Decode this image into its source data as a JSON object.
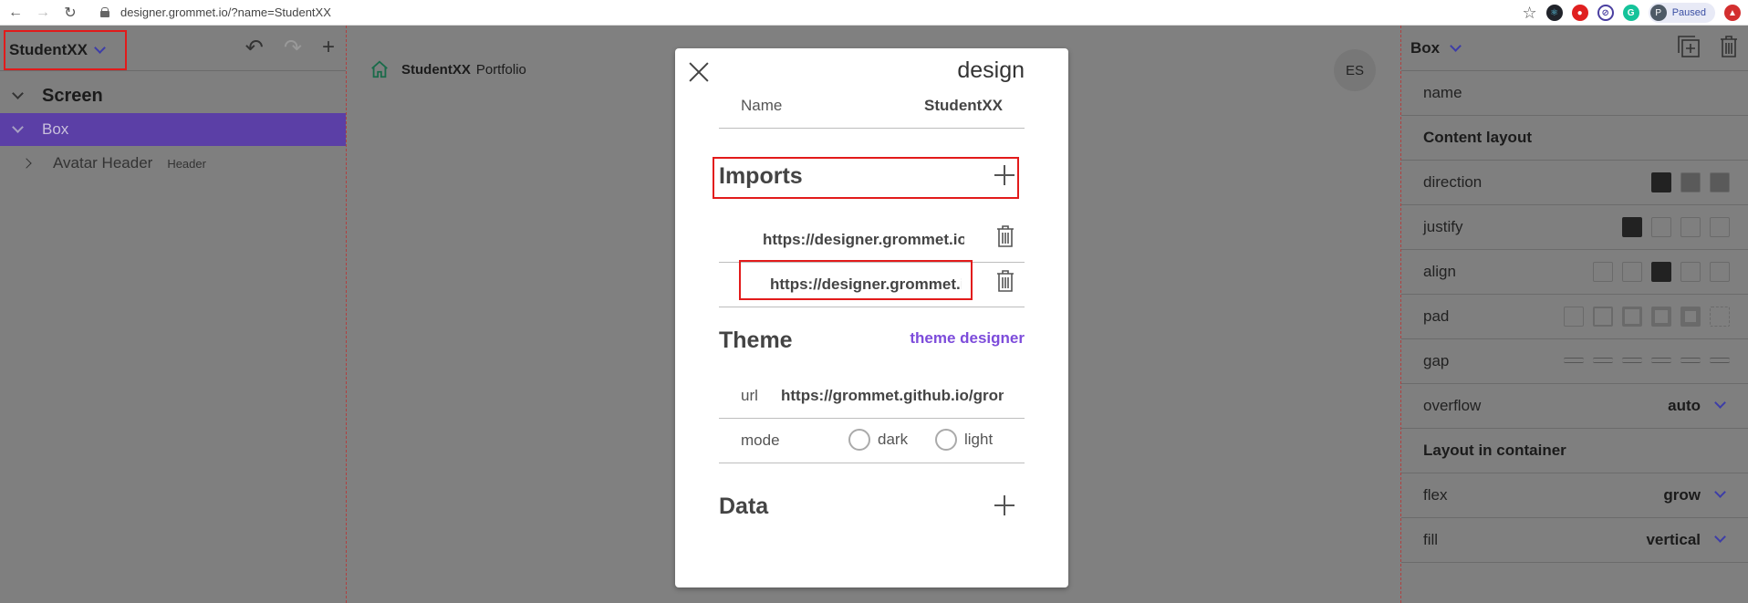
{
  "browser": {
    "url": "designer.grommet.io/?name=StudentXX",
    "profile_initial": "P",
    "profile_status": "Paused"
  },
  "left_panel": {
    "project_name": "StudentXX",
    "tree": {
      "screen": "Screen",
      "box": "Box",
      "avatar_header": "Avatar Header",
      "avatar_header_type": "Header"
    }
  },
  "canvas": {
    "brand_name": "StudentXX",
    "brand_suffix": "Portfolio",
    "avatar_initials": "ES"
  },
  "right_panel": {
    "component": "Box",
    "rows": {
      "name": "name",
      "content_layout": "Content layout",
      "direction": "direction",
      "justify": "justify",
      "align": "align",
      "pad": "pad",
      "gap": "gap",
      "overflow": "overflow",
      "overflow_value": "auto",
      "layout_in_container": "Layout in container",
      "flex": "flex",
      "flex_value": "grow",
      "fill": "fill",
      "fill_value": "vertical"
    }
  },
  "modal": {
    "title": "design",
    "name_label": "Name",
    "name_value": "StudentXX",
    "imports_title": "Imports",
    "imports": [
      "https://designer.grommet.io/",
      "https://designer.grommet.io/"
    ],
    "theme_title": "Theme",
    "theme_link": "theme designer",
    "url_label": "url",
    "url_value": "https://grommet.github.io/grommet-theme",
    "mode_label": "mode",
    "mode_dark": "dark",
    "mode_light": "light",
    "data_title": "Data"
  }
}
